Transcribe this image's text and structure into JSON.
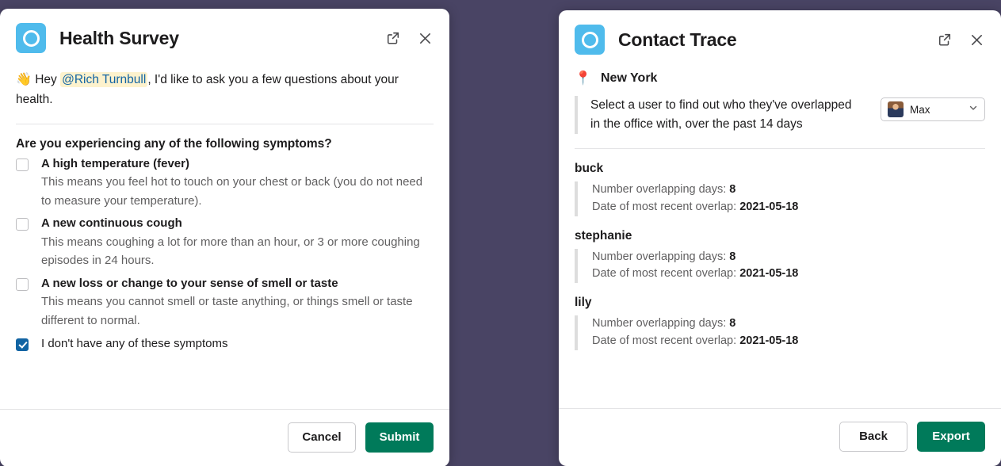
{
  "background_color": "#494464",
  "health_survey": {
    "title": "Health Survey",
    "logo_icon": "circle-ring-logo",
    "open_external_icon": "external-link-icon",
    "close_icon": "close-icon",
    "intro": {
      "emoji": "👋",
      "before_mention": " Hey ",
      "mention": "@Rich Turnbull",
      "after_mention": ", I'd like to ask you a few questions about your health."
    },
    "question": "Are you experiencing any of the following symptoms?",
    "symptoms": [
      {
        "label": "A high temperature (fever)",
        "description": "This means you feel hot to touch on your chest or back (you do not need to measure your temperature).",
        "checked": false
      },
      {
        "label": "A new continuous cough",
        "description": "This means coughing a lot for more than an hour, or 3 or more coughing episodes in 24 hours.",
        "checked": false
      },
      {
        "label": "A new loss or change to your sense of smell or taste",
        "description": "This means you cannot smell or taste anything, or things smell or taste different to normal.",
        "checked": false
      },
      {
        "label": "I don't have any of these symptoms",
        "description": "",
        "checked": true
      }
    ],
    "footer": {
      "cancel_label": "Cancel",
      "submit_label": "Submit",
      "primary_color": "#007a5a"
    }
  },
  "contact_trace": {
    "title": "Contact Trace",
    "logo_icon": "circle-ring-logo",
    "open_external_icon": "external-link-icon",
    "close_icon": "close-icon",
    "location": {
      "pin_emoji": "📍",
      "name": "New York"
    },
    "select_prompt": "Select a user to find out who they've overlapped in the office with, over the past 14 days",
    "user_select": {
      "selected_name": "Max",
      "avatar_icon": "user-avatar",
      "chevron_icon": "chevron-down-icon"
    },
    "people": [
      {
        "name": "buck",
        "days_label": "Number overlapping days:",
        "days_value": "8",
        "date_label": "Date of most recent overlap:",
        "date_value": "2021-05-18"
      },
      {
        "name": "stephanie",
        "days_label": "Number overlapping days:",
        "days_value": "8",
        "date_label": "Date of most recent overlap:",
        "date_value": "2021-05-18"
      },
      {
        "name": "lily",
        "days_label": "Number overlapping days:",
        "days_value": "8",
        "date_label": "Date of most recent overlap:",
        "date_value": "2021-05-18"
      }
    ],
    "footer": {
      "back_label": "Back",
      "export_label": "Export",
      "primary_color": "#007a5a"
    }
  }
}
